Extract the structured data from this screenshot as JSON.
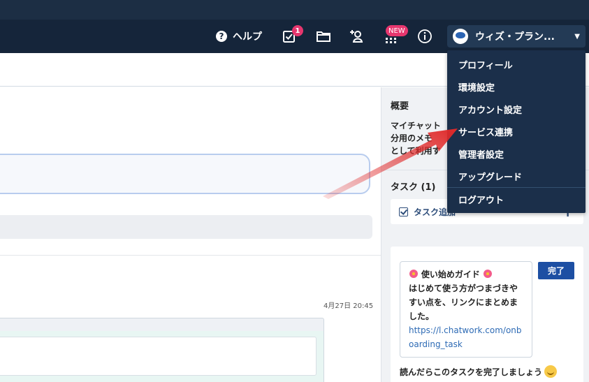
{
  "header": {
    "help_label": "ヘルプ",
    "task_badge": "1",
    "new_badge": "NEW",
    "account_name": "ウィズ・プラン..."
  },
  "account_menu": {
    "items": [
      {
        "label": "プロフィール"
      },
      {
        "label": "環境設定"
      },
      {
        "label": "アカウント設定"
      },
      {
        "label": "サービス連携"
      },
      {
        "label": "管理者設定"
      },
      {
        "label": "アップグレード"
      },
      {
        "label": "ログアウト"
      }
    ]
  },
  "main": {
    "message_timestamp": "4月27日 20:45"
  },
  "side": {
    "summary_title": "概要",
    "summary_line1": "マイチャット",
    "summary_line2": "分用のメモ",
    "summary_line3": "として利用す",
    "tasks_title": "タスク (1)",
    "task_add_label": "タスク追加",
    "task_guide_title": "使い始めガイド",
    "task_guide_body": "はじめて使う方がつまづきやすい点を、リンクにまとめました。",
    "task_guide_link": "https://l.chatwork.com/onboarding_task",
    "task_done_label": "完了",
    "task_complete_prompt": "読んだらこのタスクを完了しましょう"
  },
  "colors": {
    "topbar": "#15253a",
    "menu": "#1b2f4a",
    "badge": "#e6366e",
    "done_button": "#1d4fa3",
    "arrow": "#e02a2a"
  }
}
